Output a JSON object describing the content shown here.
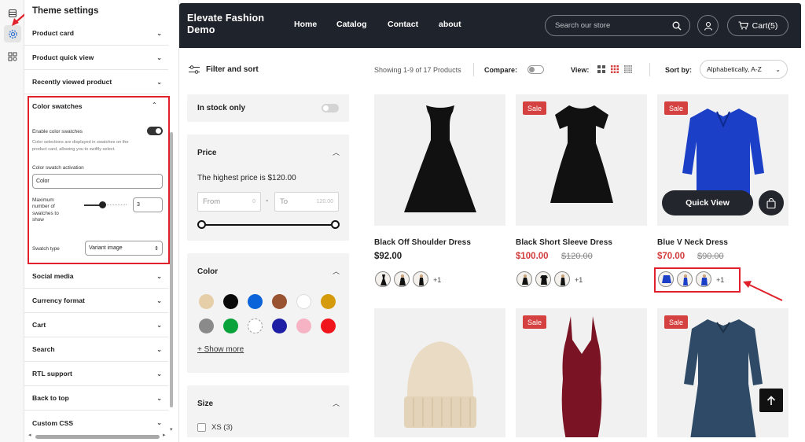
{
  "theme_panel": {
    "title": "Theme settings",
    "sections_top": [
      "Product card",
      "Product quick view",
      "Recently viewed product"
    ],
    "color_swatches": {
      "title": "Color swatches",
      "enable_label": "Enable color swatches",
      "enable_note_1": "Color selections are displayed in swatches on the",
      "enable_note_2": "product card, allowing you to swiftly select.",
      "activation_label": "Color swatch activation",
      "activation_value": "Color",
      "max_label_1": "Maximum",
      "max_label_2": "number of",
      "max_label_3": "swatches to",
      "max_label_4": "show",
      "max_value": "3",
      "type_label": "Swatch type",
      "type_value": "Variant image"
    },
    "sections_bottom": [
      "Social media",
      "Currency format",
      "Cart",
      "Search",
      "RTL support",
      "Back to top",
      "Custom CSS"
    ]
  },
  "store": {
    "logo_line1": "Elevate Fashion",
    "logo_line2": "Demo",
    "nav": [
      "Home",
      "Catalog",
      "Contact",
      "about"
    ],
    "search_placeholder": "Search our store",
    "cart_label": "Cart(5)"
  },
  "filters": {
    "heading": "Filter and sort",
    "in_stock": "In stock only",
    "price_title": "Price",
    "highest_price": "The highest price is $120.00",
    "from_label": "From",
    "from_value": "0",
    "dash": "-",
    "to_label": "To",
    "to_value": "120.00",
    "color_title": "Color",
    "colors": [
      "#e6cfa8",
      "#0a0a0a",
      "#0b63d9",
      "#9a5330",
      "#ffffff",
      "#d59b0c",
      "#8a8a8a",
      "#0aa33b",
      "#ffffff",
      "#1f1fa6",
      "#f5b3c4",
      "#f0141c"
    ],
    "show_more": "+ Show more",
    "size_title": "Size",
    "size_option": "XS (3)"
  },
  "toolbar": {
    "showing": "Showing 1-9 of 17 Products",
    "compare": "Compare:",
    "view": "View:",
    "sort_label": "Sort by:",
    "sort_value": "Alphabetically, A-Z"
  },
  "products": [
    {
      "name": "Black Off Shoulder Dress",
      "price": "$92.00",
      "old_price": "",
      "sale": false,
      "more": "+1"
    },
    {
      "name": "Black Short Sleeve Dress",
      "price": "$100.00",
      "old_price": "$120.00",
      "sale": true,
      "more": "+1"
    },
    {
      "name": "Blue V Neck Dress",
      "price": "$70.00",
      "old_price": "$90.00",
      "sale": true,
      "more": "+1"
    }
  ],
  "sale_badge": "Sale",
  "quick_view": "Quick View"
}
